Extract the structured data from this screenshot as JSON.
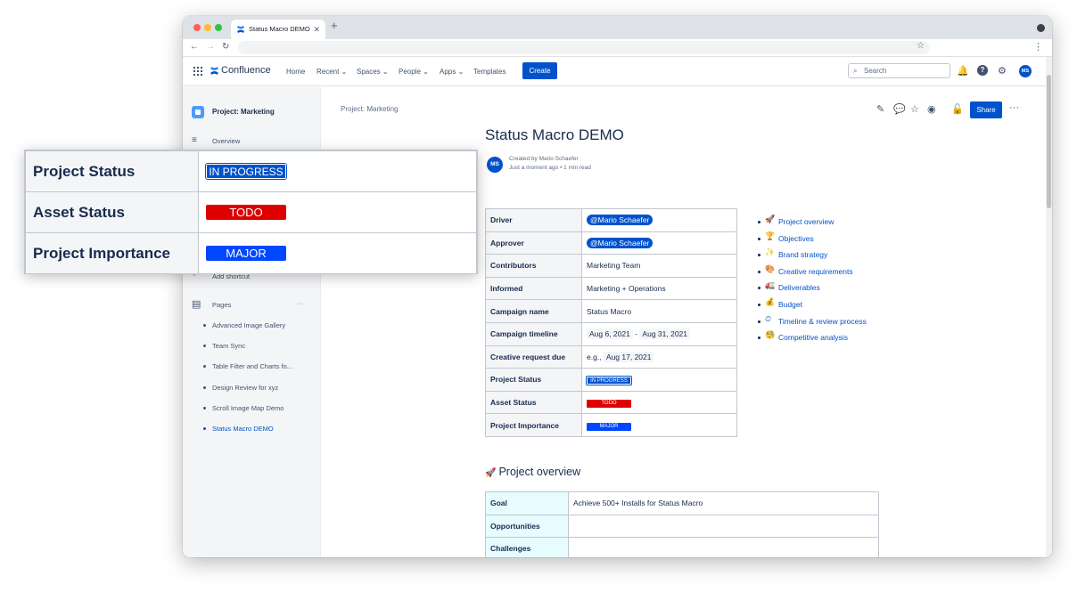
{
  "browser": {
    "tab_title": "Status Macro DEMO",
    "tab_close": "✕",
    "new_tab": "+",
    "back": "←",
    "forward": "→",
    "reload": "↻",
    "bookmark": "☆",
    "menu": "⋮"
  },
  "header": {
    "app_name": "Confluence",
    "nav": [
      "Home",
      "Recent",
      "Spaces",
      "People",
      "Apps",
      "Templates"
    ],
    "create_label": "Create",
    "search_placeholder": "Search",
    "user_initials": "MS"
  },
  "sidebar": {
    "space_name": "Project: Marketing",
    "overview_label": "Overview",
    "add_shortcut_label": "Add shortcut",
    "pages_label": "Pages",
    "pages_more": "···",
    "pages": [
      "Advanced Image Gallery",
      "Team Sync",
      "Table Filter and Charts fo...",
      "Design Review for xyz",
      "Scroll Image Map Demo",
      "Status Macro DEMO"
    ]
  },
  "page": {
    "breadcrumb": "Project: Marketing",
    "title": "Status Macro DEMO",
    "share_label": "Share",
    "more_label": "···",
    "author_initials": "MS",
    "created_by": "Created by Mario Schaefer",
    "meta": "Just a moment ago  •  1 min read",
    "properties": [
      {
        "key": "Driver",
        "value": "@Mario Schaefer"
      },
      {
        "key": "Approver",
        "value": "@Mario Schaefer"
      },
      {
        "key": "Contributors",
        "value": "Marketing Team"
      },
      {
        "key": "Informed",
        "value": "Marketing + Operations"
      },
      {
        "key": "Campaign name",
        "value": "Status Macro"
      },
      {
        "key": "Campaign timeline",
        "date_start": "Aug 6, 2021",
        "date_sep": " - ",
        "date_end": "Aug 31, 2021"
      },
      {
        "key": "Creative request due",
        "value_prefix": "e.g., ",
        "date": "Aug 17, 2021"
      },
      {
        "key": "Project Status",
        "status": "IN PROGRESS"
      },
      {
        "key": "Asset Status",
        "status": "TODO"
      },
      {
        "key": "Project Importance",
        "status": "MAJOR"
      }
    ],
    "toc": [
      {
        "emoji": "🚀",
        "label": "Project overview"
      },
      {
        "emoji": "🏆",
        "label": "Objectives"
      },
      {
        "emoji": "✨",
        "label": "Brand strategy"
      },
      {
        "emoji": "🎨",
        "label": "Creative requirements"
      },
      {
        "emoji": "🚛",
        "label": "Deliverables"
      },
      {
        "emoji": "💰",
        "label": "Budget"
      },
      {
        "emoji": "⏲",
        "label": "Timeline & review process"
      },
      {
        "emoji": "🧐",
        "label": "Competitive analysis"
      }
    ],
    "section_emoji": "🚀",
    "section_title": "Project overview",
    "overview_rows": [
      {
        "key": "Goal",
        "value": "Achieve 500+ Installs for Status Macro"
      },
      {
        "key": "Opportunities",
        "value": ""
      },
      {
        "key": "Challenges",
        "value": ""
      }
    ]
  },
  "overlay": {
    "rows": [
      {
        "key": "Project Status",
        "status": "IN PROGRESS"
      },
      {
        "key": "Asset Status",
        "status": "TODO"
      },
      {
        "key": "Project Importance",
        "status": "MAJOR"
      }
    ]
  },
  "colors": {
    "in_progress": "#0052cc",
    "todo": "#de0000",
    "major": "#0047ff"
  }
}
